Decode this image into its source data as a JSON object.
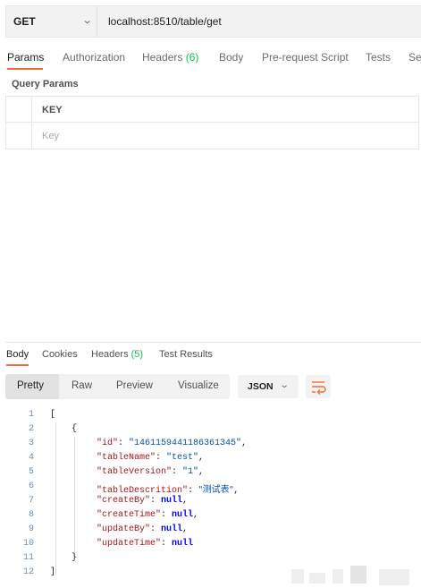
{
  "request": {
    "method": "GET",
    "url": "localhost:8510/table/get"
  },
  "request_tabs": [
    {
      "label": "Params"
    },
    {
      "label": "Authorization"
    },
    {
      "label": "Headers",
      "count": "(6)"
    },
    {
      "label": "Body"
    },
    {
      "label": "Pre-request Script"
    },
    {
      "label": "Tests"
    },
    {
      "label": "Se"
    }
  ],
  "query_params": {
    "title": "Query Params",
    "key_header": "KEY",
    "key_placeholder": "Key"
  },
  "response_tabs": [
    {
      "label": "Body"
    },
    {
      "label": "Cookies"
    },
    {
      "label": "Headers",
      "count": "(5)"
    },
    {
      "label": "Test Results"
    }
  ],
  "format": {
    "views": [
      "Pretty",
      "Raw",
      "Preview",
      "Visualize"
    ],
    "selected_view": "Pretty",
    "language": "JSON"
  },
  "response_body": {
    "line_numbers": [
      "1",
      "2",
      "3",
      "4",
      "5",
      "6",
      "7",
      "8",
      "9",
      "10",
      "11",
      "12"
    ],
    "open_bracket": "[",
    "open_brace": "{",
    "close_brace": "}",
    "close_bracket": "]",
    "fields": [
      {
        "key": "\"id\"",
        "value": "\"1461159441186361345\"",
        "type": "string",
        "comma": ","
      },
      {
        "key": "\"tableName\"",
        "value": "\"test\"",
        "type": "string",
        "comma": ","
      },
      {
        "key": "\"tableVersion\"",
        "value": "\"1\"",
        "type": "string",
        "comma": ","
      },
      {
        "key": "\"tableDescrition\"",
        "value": "\"测试表\"",
        "type": "string",
        "comma": ","
      },
      {
        "key": "\"createBy\"",
        "value": "null",
        "type": "null",
        "comma": ","
      },
      {
        "key": "\"createTime\"",
        "value": "null",
        "type": "null",
        "comma": ","
      },
      {
        "key": "\"updateBy\"",
        "value": "null",
        "type": "null",
        "comma": ","
      },
      {
        "key": "\"updateTime\"",
        "value": "null",
        "type": "null",
        "comma": ""
      }
    ]
  },
  "colors": {
    "accent": "#f26b3a",
    "count_green": "#0cbb52",
    "json_key": "#a31515",
    "json_string": "#0451a5",
    "json_null": "#0000ff"
  }
}
